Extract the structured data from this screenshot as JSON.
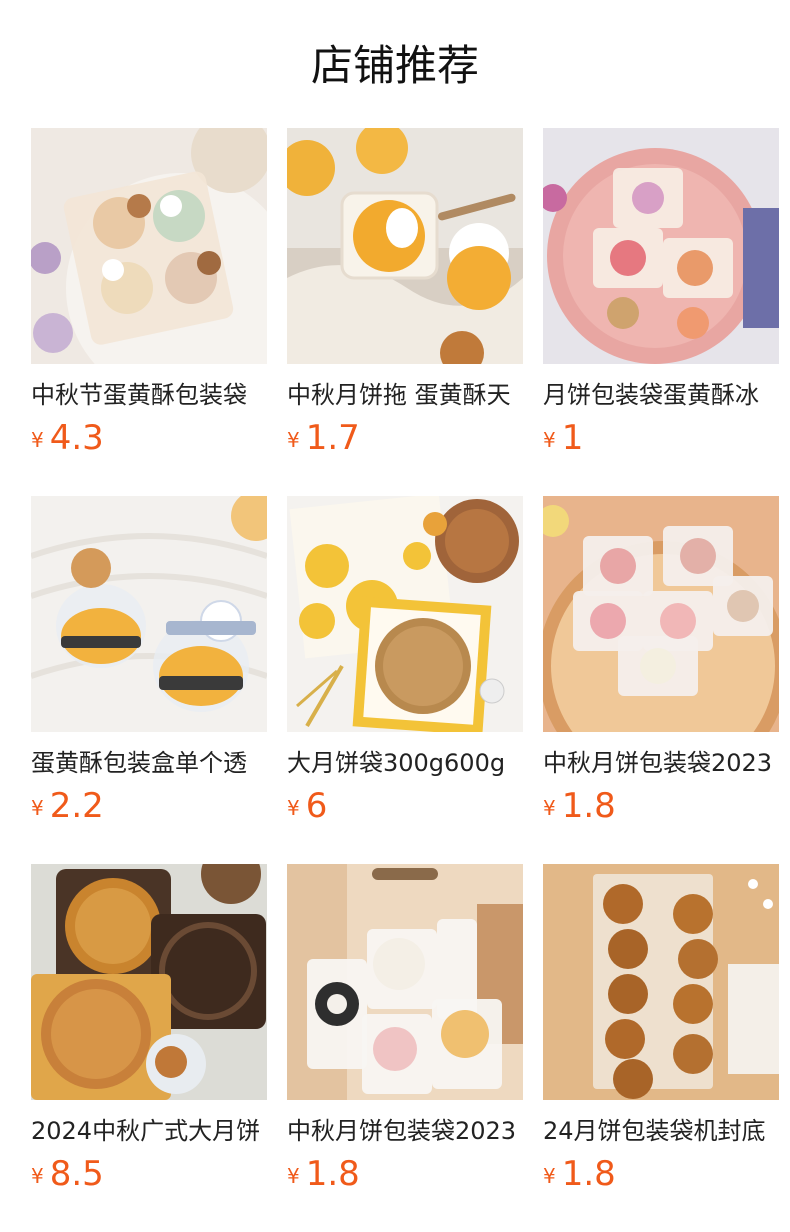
{
  "header": {
    "title": "店铺推荐"
  },
  "currency_symbol": "¥",
  "products": [
    {
      "name": "中秋节蛋黄酥包装袋",
      "price": "4.3",
      "image": "bunny-bear-mooncake-bags-on-plate"
    },
    {
      "name": "中秋月饼拖 蛋黄酥天",
      "price": "1.7",
      "image": "egg-yolk-pastry-in-clear-cups"
    },
    {
      "name": "月饼包装袋蛋黄酥冰",
      "price": "1",
      "image": "snow-skin-mooncakes-on-pink-plate"
    },
    {
      "name": "蛋黄酥包装盒单个透",
      "price": "2.2",
      "image": "dome-boxes-with-bear-bunny-tags"
    },
    {
      "name": "大月饼袋300g600g",
      "price": "6",
      "image": "yellow-flower-gift-box"
    },
    {
      "name": "中秋月饼包装袋2023",
      "price": "1.8",
      "image": "flower-mooncakes-on-wood-tray"
    },
    {
      "name": "2024中秋广式大月饼",
      "price": "8.5",
      "image": "large-cantonese-mooncake-trays"
    },
    {
      "name": "中秋月饼包装袋2023",
      "price": "1.8",
      "image": "pingan-xile-sealing-bags"
    },
    {
      "name": "24月饼包装袋机封底",
      "price": "1.8",
      "image": "mooncakes-in-sealed-bags-grid"
    }
  ],
  "colors": {
    "price": "#f05a1a",
    "title": "#111111",
    "name": "#222222"
  }
}
